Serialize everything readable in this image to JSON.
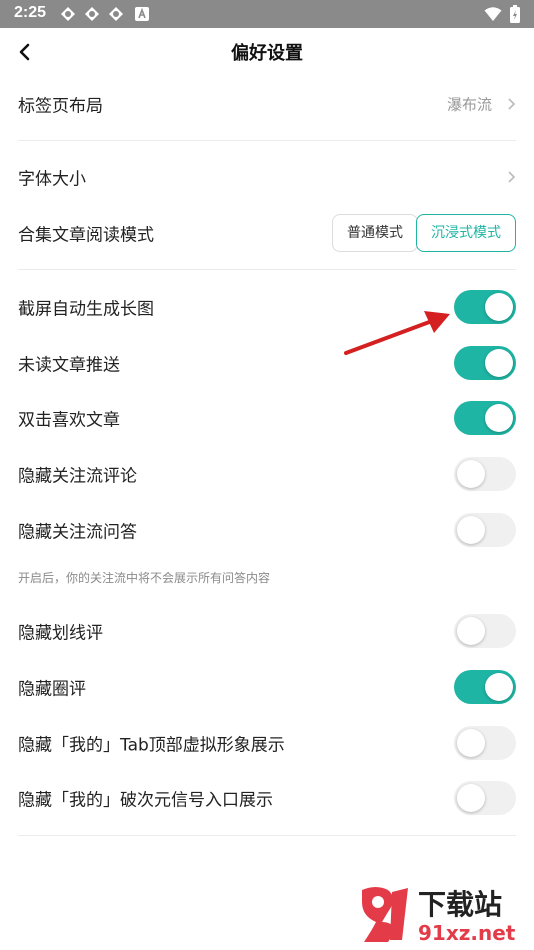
{
  "status_bar": {
    "time": "2:25",
    "icons": [
      "app-icon",
      "app-icon",
      "app-icon",
      "a-icon"
    ],
    "right_icons": [
      "wifi-icon",
      "battery-icon"
    ]
  },
  "nav": {
    "title": "偏好设置",
    "back_icon": "chevron-left-icon"
  },
  "rows": {
    "tab_layout": {
      "label": "标签页布局",
      "value": "瀑布流"
    },
    "font_size": {
      "label": "字体大小"
    },
    "reading_mode": {
      "label": "合集文章阅读模式",
      "normal": "普通模式",
      "immersive": "沉浸式模式",
      "selected": "沉浸式模式"
    },
    "screenshot_long": {
      "label": "截屏自动生成长图",
      "on": true
    },
    "unread_push": {
      "label": "未读文章推送",
      "on": true
    },
    "double_tap_like": {
      "label": "双击喜欢文章",
      "on": true
    },
    "hide_follow_comments": {
      "label": "隐藏关注流评论",
      "on": false
    },
    "hide_follow_qa": {
      "label": "隐藏关注流问答",
      "on": false
    },
    "hide_follow_qa_hint": "开启后，你的关注流中将不会展示所有问答内容",
    "hide_underline_comments": {
      "label": "隐藏划线评",
      "on": false
    },
    "hide_circle_comments": {
      "label": "隐藏圈评",
      "on": true
    },
    "hide_avatar_display": {
      "label": "隐藏「我的」Tab顶部虚拟形象展示",
      "on": false
    },
    "hide_dimension_entry": {
      "label": "隐藏「我的」破次元信号入口展示",
      "on": false
    }
  },
  "watermark": {
    "top": "下载站",
    "bottom": "91xz.net"
  },
  "colors": {
    "accent": "#1eb5a4",
    "toggle_off": "#f0f0f0",
    "annotation_arrow": "#d42020",
    "status_bar": "#8a8a8a"
  }
}
